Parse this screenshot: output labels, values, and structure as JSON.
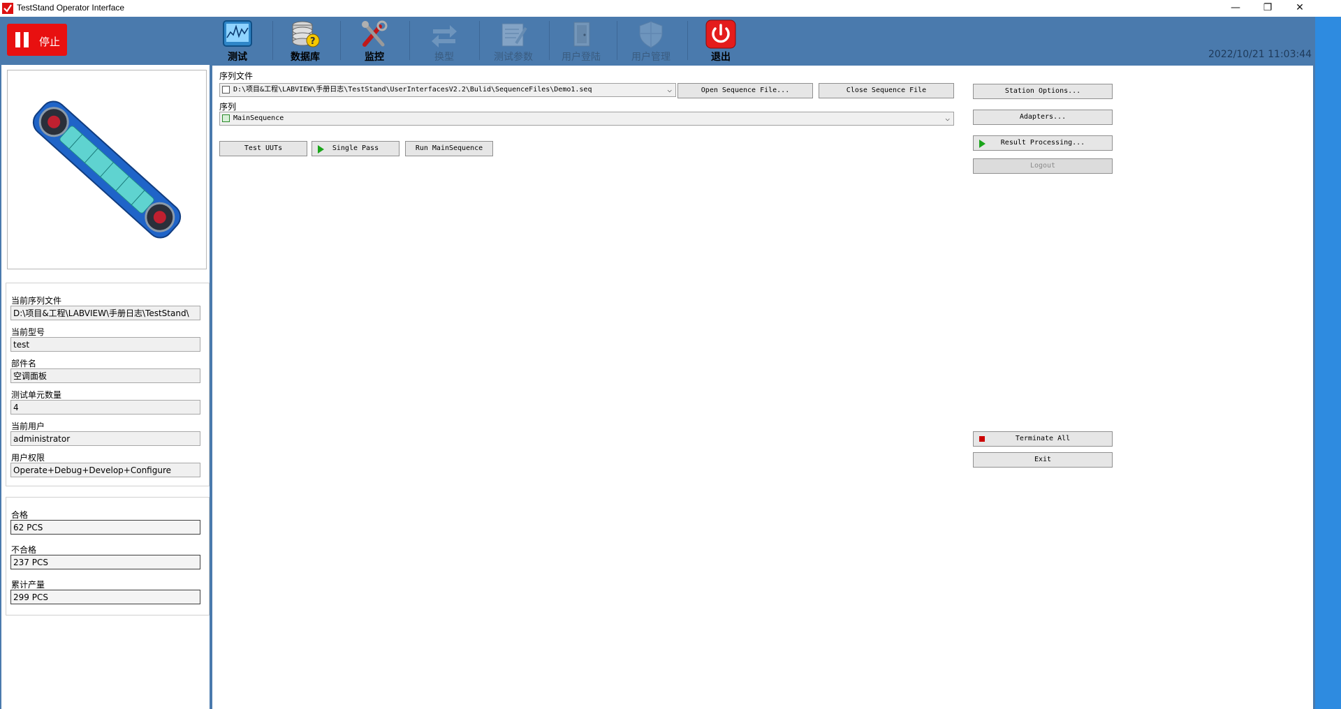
{
  "window": {
    "title": "TestStand Operator Interface",
    "minimize_glyph": "—",
    "restore_glyph": "❐",
    "close_glyph": "✕"
  },
  "toolbar": {
    "stop_label": "停止",
    "items": [
      {
        "label": "测试",
        "icon": "chart-monitor-icon",
        "enabled": true
      },
      {
        "label": "数据库",
        "icon": "database-icon",
        "enabled": true
      },
      {
        "label": "监控",
        "icon": "tools-icon",
        "enabled": true
      },
      {
        "label": "换型",
        "icon": "swap-arrows-icon",
        "enabled": false
      },
      {
        "label": "测试参数",
        "icon": "document-edit-icon",
        "enabled": false
      },
      {
        "label": "用户登陆",
        "icon": "door-login-icon",
        "enabled": false
      },
      {
        "label": "用户管理",
        "icon": "shield-icon",
        "enabled": false
      },
      {
        "label": "退出",
        "icon": "power-icon",
        "enabled": true
      }
    ],
    "datetime": "2022/10/21 11:03:44"
  },
  "info": {
    "fields": [
      {
        "label": "当前序列文件",
        "value": "D:\\项目&工程\\LABVIEW\\手册日志\\TestStand\\"
      },
      {
        "label": "当前型号",
        "value": "test"
      },
      {
        "label": "部件名",
        "value": "空调面板"
      },
      {
        "label": "测试单元数量",
        "value": "4"
      },
      {
        "label": "当前用户",
        "value": "administrator"
      },
      {
        "label": "用户权限",
        "value": "Operate+Debug+Develop+Configure"
      }
    ]
  },
  "stats": {
    "fields": [
      {
        "label": "合格",
        "value": "62 PCS"
      },
      {
        "label": "不合格",
        "value": "237 PCS"
      },
      {
        "label": "累计产量",
        "value": "299 PCS"
      }
    ]
  },
  "main": {
    "seqfile_label": "序列文件",
    "seqfile_value": "D:\\项目&工程\\LABVIEW\\手册日志\\TestStand\\UserInterfacesV2.2\\Bulid\\SequenceFiles\\Demo1.seq",
    "sequence_label": "序列",
    "sequence_value": "MainSequence",
    "open_label": "Open Sequence File...",
    "close_label": "Close Sequence File",
    "test_uuts_label": "Test UUTs",
    "single_pass_label": "Single Pass",
    "run_main_label": "Run MainSequence",
    "station_options_label": "Station Options...",
    "adapters_label": "Adapters...",
    "result_processing_label": "Result Processing...",
    "logout_label": "Logout",
    "terminate_all_label": "Terminate All",
    "exit_label": "Exit"
  },
  "colors": {
    "app_blue": "#4a7aad",
    "stop_red": "#e81010",
    "right_edge_blue": "#2e8be0"
  }
}
